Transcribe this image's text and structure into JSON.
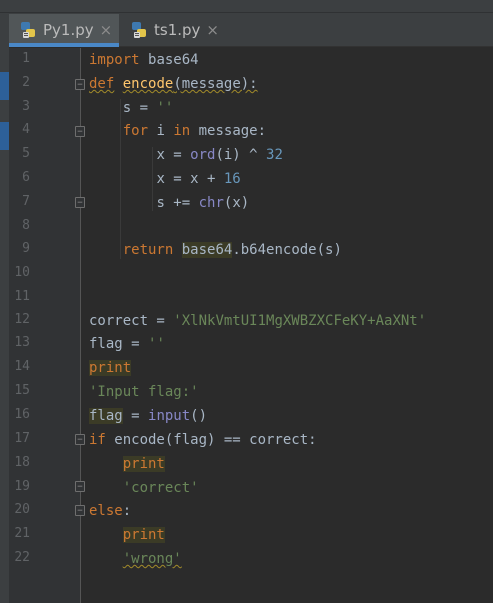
{
  "tabs": [
    {
      "label": "Py1.py",
      "active": true
    },
    {
      "label": "ts1.py",
      "active": false
    }
  ],
  "tab_close_glyph": "×",
  "line_numbers": [
    "1",
    "2",
    "3",
    "4",
    "5",
    "6",
    "7",
    "8",
    "9",
    "10",
    "11",
    "12",
    "13",
    "14",
    "15",
    "16",
    "17",
    "18",
    "19",
    "20",
    "21",
    "22"
  ],
  "code": {
    "l1": {
      "kw": "import",
      "mod": "base64"
    },
    "l2": {
      "kw": "def",
      "fn": "encode",
      "args": "(message):"
    },
    "l3": {
      "var": "s = ",
      "str": "''"
    },
    "l4": {
      "kw1": "for",
      "mid": " i ",
      "kw2": "in",
      "rest": " message:"
    },
    "l5": {
      "pre": "x = ",
      "bi": "ord",
      "mid": "(i) ^ ",
      "num": "32"
    },
    "l6": {
      "pre": "x = x + ",
      "num": "16"
    },
    "l7": {
      "pre": "s += ",
      "bi": "chr",
      "rest": "(x)"
    },
    "l9": {
      "kw": "return",
      "mod": "base64",
      "rest": ".b64encode(s)"
    },
    "l12": {
      "pre": "correct = ",
      "str": "'XlNkVmtUI1MgXWBZXCFeKY+AaXNt'"
    },
    "l13": {
      "pre": "flag = ",
      "str": "''"
    },
    "l14": {
      "kw": "print"
    },
    "l15": {
      "str": "'Input flag:'"
    },
    "l16": {
      "var": "flag",
      "mid": " = ",
      "bi": "input",
      "rest": "()"
    },
    "l17": {
      "kw": "if",
      "rest": " encode(flag) == correct:"
    },
    "l18": {
      "kw": "print"
    },
    "l19": {
      "str": "'correct'"
    },
    "l20": {
      "kw": "else",
      "rest": ":"
    },
    "l21": {
      "kw": "print"
    },
    "l22": {
      "str": "'wrong'"
    }
  },
  "colors": {
    "keyword": "#cc7832",
    "string": "#6a8759",
    "number": "#6897bb",
    "builtin": "#8888c6",
    "function": "#ffc66d",
    "text": "#a9b7c6",
    "background": "#2b2b2b"
  },
  "icons": {
    "tab": "python-file-icon",
    "fold": "fold-marker-icon"
  }
}
